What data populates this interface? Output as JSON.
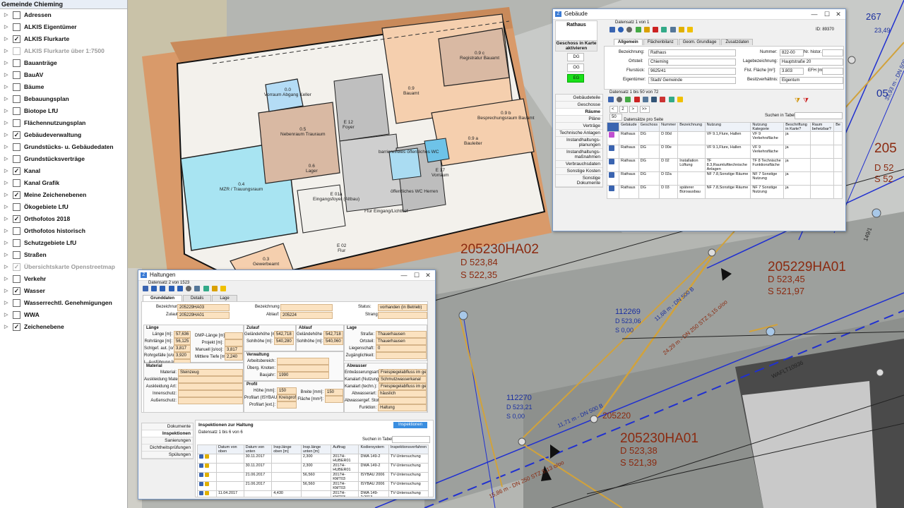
{
  "sidebar": {
    "title": "Gemeinde Chieming",
    "layers": [
      {
        "label": "Adressen",
        "checked": false,
        "dim": false
      },
      {
        "label": "ALKIS Eigentümer",
        "checked": false,
        "dim": false
      },
      {
        "label": "ALKIS Flurkarte",
        "checked": true,
        "dim": false
      },
      {
        "label": "ALKIS Flurkarte über 1:7500",
        "checked": false,
        "dim": true
      },
      {
        "label": "Bauanträge",
        "checked": false,
        "dim": false
      },
      {
        "label": "BauAV",
        "checked": false,
        "dim": false
      },
      {
        "label": "Bäume",
        "checked": false,
        "dim": false
      },
      {
        "label": "Bebauungsplan",
        "checked": false,
        "dim": false
      },
      {
        "label": "Biotope LfU",
        "checked": false,
        "dim": false
      },
      {
        "label": "Flächennutzungsplan",
        "checked": false,
        "dim": false
      },
      {
        "label": "Gebäudeverwaltung",
        "checked": true,
        "dim": false
      },
      {
        "label": "Grundstücks- u. Gebäudedaten",
        "checked": false,
        "dim": false
      },
      {
        "label": "Grundstücksverträge",
        "checked": false,
        "dim": false
      },
      {
        "label": "Kanal",
        "checked": true,
        "dim": false
      },
      {
        "label": "Kanal Grafik",
        "checked": false,
        "dim": false
      },
      {
        "label": "Meine Zeichenebenen",
        "checked": true,
        "dim": false
      },
      {
        "label": "Ökogebiete LfU",
        "checked": false,
        "dim": false
      },
      {
        "label": "Orthofotos 2018",
        "checked": true,
        "dim": false
      },
      {
        "label": "Orthofotos historisch",
        "checked": false,
        "dim": false
      },
      {
        "label": "Schutzgebiete LfU",
        "checked": false,
        "dim": false
      },
      {
        "label": "Straßen",
        "checked": false,
        "dim": false
      },
      {
        "label": "Übersichtskarte Openstreetmap",
        "checked": true,
        "dim": true
      },
      {
        "label": "Verkehr",
        "checked": false,
        "dim": false
      },
      {
        "label": "Wasser",
        "checked": true,
        "dim": false
      },
      {
        "label": "Wasserrechtl. Genehmigungen",
        "checked": false,
        "dim": false
      },
      {
        "label": "WWA",
        "checked": false,
        "dim": false
      },
      {
        "label": "Zeichenebene",
        "checked": true,
        "dim": false
      }
    ]
  },
  "map": {
    "rooms": [
      {
        "num": "0.0",
        "name": "Vorraum Abgang Keller"
      },
      {
        "num": "0.9 c",
        "name": "Registratur Bauamt"
      },
      {
        "num": "0.9",
        "name": "Bauamt"
      },
      {
        "num": "0.9 b",
        "name": "Besprechungsraum Bauamt"
      },
      {
        "num": "0.9 a",
        "name": "Bauleiter"
      },
      {
        "num": "0.5",
        "name": "Nebenraum Trauraum"
      },
      {
        "num": "0.6",
        "name": "Lager"
      },
      {
        "num": "E 12",
        "name": "Foyer"
      },
      {
        "num": "0.4",
        "name": "MZR / Trauungsraum"
      },
      {
        "num": "0.3",
        "name": "Gewerbeamt"
      },
      {
        "num": "E 01a",
        "name": "Eingangsfoyer (Altbau)"
      },
      {
        "num": "E 02",
        "name": "Flur"
      },
      {
        "num": "E 17",
        "name": "Vorraum"
      },
      {
        "num": "",
        "name": "barrierefreies öffentliches WC"
      },
      {
        "num": "",
        "name": "öffentliches WC Herren"
      },
      {
        "num": "",
        "name": "Flur Eingang/Lichthof"
      }
    ],
    "manholes": [
      {
        "id": "205230HA02",
        "d": "D 523,84",
        "s": "S 522,35"
      },
      {
        "id": "205229HA01",
        "d": "D 523,45",
        "s": "S 521,97"
      },
      {
        "id": "205230HA01",
        "d": "D 523,38",
        "s": "S 521,39"
      }
    ],
    "points": [
      {
        "id": "112269",
        "d": "D 523,06",
        "s": "S 0,00"
      },
      {
        "id": "112270",
        "d": "D 523,21",
        "s": "S 0,00"
      }
    ],
    "pipes": [
      "11,68 m - DN 500 B",
      "24,29 m - DN 250 STZ 5,15 o/oo",
      "11,71 m - DN 500 B",
      "33,93 m - DN 500 B",
      "15,86 m - DN 250 STZ 5,13 o/oo",
      "149/1",
      "WAFLT10936",
      "205220"
    ],
    "edge_labels": [
      "267",
      "23,49",
      "05",
      "205",
      "D 52",
      "S 52"
    ]
  },
  "gebaeude": {
    "title": "Gebäude",
    "record_info": "Datensatz 1 von 1",
    "id_label": "ID: 89370",
    "name": "Rathaus",
    "floors_title": "Geschoss in Karte aktivieren",
    "floors": [
      "DG",
      "OG",
      "EG"
    ],
    "tabs": [
      "Allgemein",
      "Flächenbilanz",
      "Geom. Grundlage",
      "Zusatzdaten"
    ],
    "fields": {
      "bezeichnung_l": "Bezeichnung:",
      "bezeichnung": "Rathaus",
      "nummer_l": "Nummer:",
      "nummer": "822-00",
      "nrhistor_l": "Nr. histor.:",
      "nrhistor": "",
      "ortsteil_l": "Ortsteil:",
      "ortsteil": "Chieming",
      "lage_l": "Lagebezeichnung:",
      "lage": "Hauptstraße 20",
      "flurstueck_l": "Flurstück:",
      "flurstueck": "9625/41",
      "flaeche_l": "Flst. Fläche [m²]:",
      "flaeche": "3.803",
      "efh_l": "EFH [m]:",
      "efh": "",
      "eigentuemer_l": "Eigentümer:",
      "eigentuemer": "Stadt/ Gemeinde",
      "besitz_l": "Besitzverhältnis:",
      "besitz": "Eigentum"
    },
    "nav": [
      "Gebäudeteile",
      "Geschosse",
      "Räume",
      "Pläne",
      "Verträge",
      "Technische Anlagen",
      "Instandhaltungs-planungen",
      "Instandhaltungs-maßnahmen",
      "Verbrauchsdaten",
      "Sonstige Kosten",
      "Sonstige Dokumente"
    ],
    "sub_info": "Datensatz 1 bis 50 von 72",
    "page": "2",
    "per_page": "50",
    "per_page_label": "Datensätze pro Seite",
    "search_label": "Suchen in Tabelle:",
    "columns": [
      "Gebäude",
      "Geschoss",
      "Nummer",
      "Bezeichnung",
      "Nutzung",
      "Nutzung Kategorie",
      "Beschriftung in Karte?",
      "Raum beheizbar?",
      "Be"
    ],
    "rows": [
      [
        "Rathaus",
        "DG",
        "D 00d",
        "",
        "VF 9.1,Flure, Hallen",
        "VF 9 Verkehrsfläche",
        "ja",
        "",
        ""
      ],
      [
        "Rathaus",
        "DG",
        "D 00e",
        "",
        "VF 9.1,Flure, Hallen",
        "VF 9 Verkehrsfläche",
        "ja",
        "",
        ""
      ],
      [
        "Rathaus",
        "DG",
        "D 02",
        "Installation Lüftung",
        "TF 8.3,Raumlufttechnische Anlagen",
        "TF 8 Technische Funktionsfläche",
        "ja",
        "",
        ""
      ],
      [
        "Rathaus",
        "DG",
        "D 02a",
        "",
        "NF 7.8,Sonstige Räume",
        "NF 7 Sonstige Nutzung",
        "ja",
        "",
        ""
      ],
      [
        "Rathaus",
        "DG",
        "D 03",
        "späterer Büroausbau",
        "NF 7.8,Sonstige Räume",
        "NF 7 Sonstige Nutzung",
        "ja",
        "",
        ""
      ]
    ]
  },
  "haltungen": {
    "title": "Haltungen",
    "record_info": "Datensatz 2 von 1523",
    "tabs": [
      "Grunddaten",
      "Details",
      "Lage"
    ],
    "bezeichnung_l": "Bezeichnung:",
    "bezeichnung": "205229HA03",
    "bez_alt_l": "Bezeichnung alt:",
    "bez_alt": "",
    "status_l": "Status:",
    "status": "vorhanden (in Betrieb)",
    "zulauf_l": "Zulauf:",
    "zulauf": "205229HA01",
    "ablauf_l": "Ablauf:",
    "ablauf": "205224",
    "strang_l": "Strang:",
    "strang": "",
    "laenge_title": "Länge",
    "laenge": [
      [
        "Länge [m]:",
        "57,636"
      ],
      [
        "Rohrlänge [m]:",
        "56,125"
      ],
      [
        "Schlgef. aut. [o/oo]:",
        "3,817"
      ],
      [
        "Rohrgefälle [o/oo]:",
        "3,920"
      ],
      [
        "L. Ausführung [m]:",
        ""
      ]
    ],
    "laenge2": [
      [
        "DMP-Länge [m]:",
        ""
      ],
      [
        "Projekt [m]:",
        ""
      ],
      [
        "Manuell [o/oo]:",
        "3,817"
      ],
      [
        "Mittlere Tiefe [m]:",
        "2,240"
      ]
    ],
    "zulauf_title": "Zulauf",
    "zulauf_vals": [
      [
        "Geländehöhe [m]:",
        "542,718"
      ],
      [
        "Sohlhöhe [m]:",
        "540,280"
      ]
    ],
    "ablauf_title": "Ablauf",
    "ablauf_vals": [
      [
        "Geländehöhe [m]:",
        "542,718"
      ],
      [
        "Sohlhöhe [m]:",
        "540,060"
      ]
    ],
    "lage_title": "Lage",
    "lage_vals": [
      [
        "Straße:",
        "Thauerhausen"
      ],
      [
        "Ortsteil:",
        "Thauerhausen"
      ],
      [
        "Liegenschaft:",
        "0"
      ],
      [
        "Zugänglichkeit:",
        ""
      ]
    ],
    "verwaltung_title": "Verwaltung",
    "verwaltung_vals": [
      [
        "Arbeitsbereich:",
        ""
      ],
      [
        "Überg. Knoten:",
        ""
      ],
      [
        "Baujahr:",
        "1990"
      ]
    ],
    "abwasser_title": "Abwasser",
    "abwasser_vals": [
      [
        "Entwässerungsart:",
        "Freispiegelabfluss im geschlosse"
      ],
      [
        "Kanalart (Nutzung):",
        "Schmutzwasserkanal"
      ],
      [
        "Kanalart (techn.):",
        "Freispiegelabfluss im geschlosse"
      ],
      [
        "Abwasserart:",
        "häuslich"
      ],
      [
        "Abwassergef. Stoffe:",
        ""
      ],
      [
        "Funktion:",
        "Haltung"
      ]
    ],
    "material_title": "Material",
    "material_vals": [
      [
        "Material:",
        "Steinzeug"
      ],
      [
        "Auskleidung Material:",
        ""
      ],
      [
        "Auskleidung Art:",
        ""
      ],
      [
        "Innenschutz:",
        ""
      ],
      [
        "Außenschutz:",
        ""
      ]
    ],
    "profil_title": "Profil",
    "profil_vals": [
      [
        "Höhe [mm]:",
        "150"
      ],
      [
        "Profilart (ISYBAU):",
        "Kreisprofil"
      ],
      [
        "Profilart [ext.]:",
        ""
      ]
    ],
    "profil_vals2": [
      [
        "Breite [mm]:",
        "150"
      ],
      [
        "Fläche [mm²]:",
        ""
      ]
    ],
    "nav": [
      "Dokumente",
      "Inspektionen",
      "Sanierungen",
      "Dichtheitsprüfungen",
      "Spülungen"
    ],
    "insp_title": "Inspektionen zur Haltung",
    "insp_button": "Inspektionen",
    "insp_info": "Datensatz 1 bis 6 von 6",
    "insp_search": "Suchen in Tabelle:",
    "insp_cols": [
      "Datum von oben",
      "Datum von unten",
      "Insp.länge oben [m]",
      "Insp.länge unten [m]",
      "Auftrag",
      "Kodiersystem",
      "Inspektionsverfahren"
    ],
    "insp_rows": [
      [
        "",
        "30.11.2017",
        "",
        "2,300",
        "2017H-HUBER01",
        "DWA 149-2",
        "TV-Untersuchung"
      ],
      [
        "",
        "30.11.2017",
        "",
        "2,300",
        "2017H-HUBER01",
        "DWA 149-2",
        "TV-Untersuchung"
      ],
      [
        "",
        "21.06.2017",
        "",
        "56,560",
        "2017H-KMT03",
        "ISYBAU 2006",
        "TV-Untersuchung"
      ],
      [
        "",
        "21.06.2017",
        "",
        "56,560",
        "2017H-KMT03",
        "ISYBAU 2006",
        "TV-Untersuchung"
      ],
      [
        "11.04.2017",
        "",
        "4,430",
        "",
        "2017H-KMT03",
        "DWA 149-2:2013",
        "TV-Untersuchung"
      ]
    ]
  }
}
